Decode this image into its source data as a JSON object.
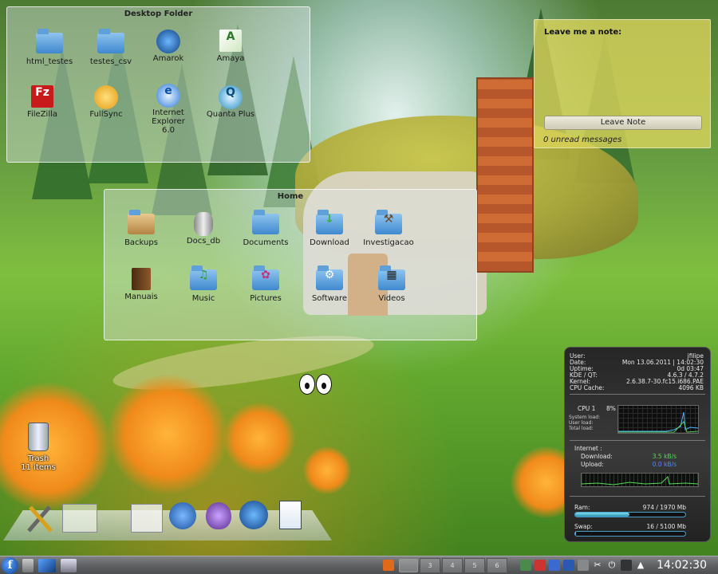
{
  "desktop_folder": {
    "title": "Desktop Folder",
    "items": [
      {
        "label": "html_testes",
        "icon": "folder-icon"
      },
      {
        "label": "testes_csv",
        "icon": "folder-icon"
      },
      {
        "label": "Amarok",
        "icon": "amarok-icon"
      },
      {
        "label": "Amaya",
        "icon": "amaya-icon"
      },
      {
        "label": "FileZilla",
        "icon": "filezilla-icon"
      },
      {
        "label": "FullSync",
        "icon": "fullsync-icon"
      },
      {
        "label": "Internet Explorer 6.0",
        "icon": "internet-explorer-icon"
      },
      {
        "label": "Quanta Plus",
        "icon": "quanta-icon"
      }
    ]
  },
  "home_folder": {
    "title": "Home",
    "items": [
      {
        "label": "Backups",
        "icon": "folder-backups-icon"
      },
      {
        "label": "Docs_db",
        "icon": "database-icon"
      },
      {
        "label": "Documents",
        "icon": "folder-documents-icon"
      },
      {
        "label": "Download",
        "icon": "folder-download-icon"
      },
      {
        "label": "Investigacao",
        "icon": "folder-tools-icon"
      },
      {
        "label": "Manuais",
        "icon": "book-icon"
      },
      {
        "label": "Music",
        "icon": "folder-music-icon"
      },
      {
        "label": "Pictures",
        "icon": "folder-pictures-icon"
      },
      {
        "label": "Software",
        "icon": "folder-software-icon"
      },
      {
        "label": "Videos",
        "icon": "folder-videos-icon"
      }
    ]
  },
  "note": {
    "title": "Leave me a note:",
    "button": "Leave Note",
    "status": "0 unread messages"
  },
  "trash": {
    "label": "Trash",
    "count": "11 items"
  },
  "sysmon": {
    "user_k": "User:",
    "user_v": "jfilipe",
    "date_k": "Date:",
    "date_v": "Mon 13.06.2011 | 14:02:30",
    "uptime_k": "Uptime:",
    "uptime_v": "0d 03:47",
    "kde_k": "KDE / QT:",
    "kde_v": "4.6.3 / 4.7.2",
    "kernel_k": "Kernel:",
    "kernel_v": "2.6.38.7-30.fc15.i686.PAE",
    "cache_k": "CPU Cache:",
    "cache_v": "4096 KB",
    "cpu_label": "CPU 1",
    "cpu_percent": "8%",
    "sys_load": "System load:",
    "user_load": "User load:",
    "total_load": "Total load:",
    "internet": "Internet :",
    "download_k": "Download:",
    "download_v": "3.5 kB/s",
    "upload_k": "Upload:",
    "upload_v": "0.0 kB/s",
    "ram_k": "Ram:",
    "ram_v": "974 / 1970 Mb",
    "ram_fraction": 0.49,
    "swap_k": "Swap:",
    "swap_v": "16 / 5100 Mb",
    "swap_fraction": 0.003
  },
  "taskbar": {
    "pager": [
      "3",
      "4",
      "5",
      "6"
    ],
    "clock": "14:02:30"
  },
  "colors": {
    "note_bg": "#ded65c",
    "sysmon_bg": "#2a2a2a",
    "download_value": "#55dd55",
    "upload_value": "#4a8cff"
  }
}
